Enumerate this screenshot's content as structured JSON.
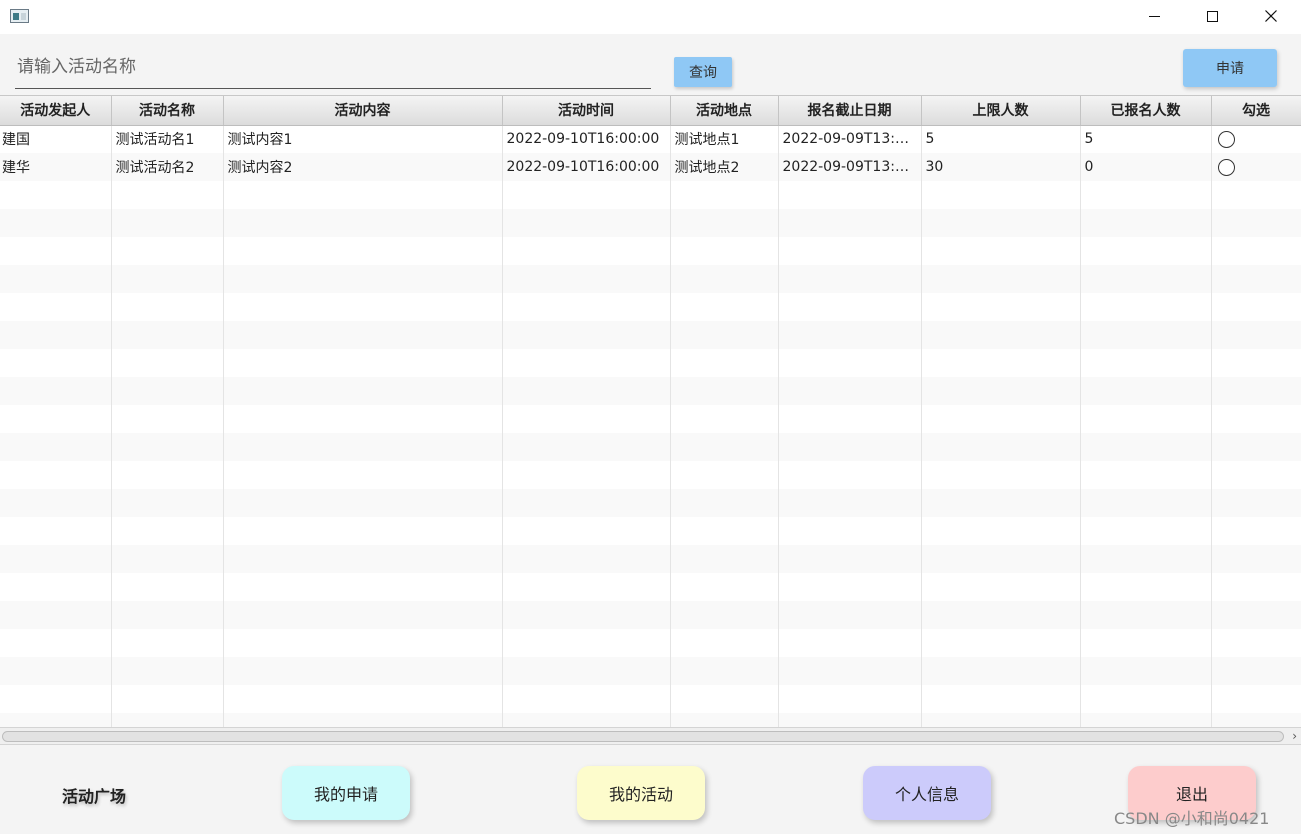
{
  "window": {
    "icons": {
      "app": "app-window-icon",
      "minimize": "minimize-icon",
      "maximize": "maximize-icon",
      "close": "close-icon"
    }
  },
  "search": {
    "placeholder": "请输入活动名称",
    "value": "",
    "query_label": "查询"
  },
  "apply_label": "申请",
  "table": {
    "columns": [
      "活动发起人",
      "活动名称",
      "活动内容",
      "活动时间",
      "活动地点",
      "报名截止日期",
      "上限人数",
      "已报名人数",
      "勾选"
    ],
    "rows": [
      [
        "建国",
        "测试活动名1",
        "测试内容1",
        "2022-09-10T16:00:00",
        "测试地点1",
        "2022-09-09T13:0...",
        "5",
        "5"
      ],
      [
        "建华",
        "测试活动名2",
        "测试内容2",
        "2022-09-10T16:00:00",
        "测试地点2",
        "2022-09-09T13:0...",
        "30",
        "0"
      ]
    ]
  },
  "nav": {
    "current": "活动广场",
    "my_applications": "我的申请",
    "my_activities": "我的活动",
    "profile": "个人信息",
    "exit": "退出"
  },
  "watermark": "CSDN @小和尚0421",
  "colors": {
    "button_blue": "#8fc8f5",
    "nav_cyan": "#ccfbfb",
    "nav_yellow": "#fdfccc",
    "nav_purple": "#cccbfb",
    "nav_pink": "#fdcccc"
  }
}
